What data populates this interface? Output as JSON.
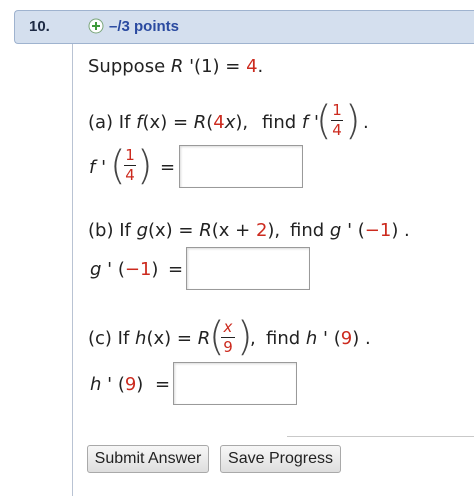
{
  "question": {
    "number": "10.",
    "points": "–/3 points"
  },
  "intro": {
    "text_a": "Suppose ",
    "var": "R",
    "text_b": " '(1) = ",
    "value": "4",
    "text_c": "."
  },
  "part_a": {
    "label": "(a) If ",
    "f": "f",
    "x1": "(x)",
    "eq": " = ",
    "R": "R",
    "arg_open": "(",
    "coef": "4",
    "x2": "x",
    "arg_close": "),",
    "find": "find ",
    "fprime": "f",
    "prime": " '",
    "frac_num": "1",
    "frac_den": "4",
    "period": ".",
    "answer_prefix_f": "f",
    "answer_prime": " '",
    "answer_eq": "=",
    "answer_value": ""
  },
  "part_b": {
    "label": "(b) If ",
    "g": "g",
    "x1": "(x)",
    "eq": " = ",
    "R": "R",
    "arg_a": "(x + ",
    "shift": "2",
    "arg_b": "),",
    "find": "find ",
    "gprime": "g",
    "prime_open": " ' (",
    "point": "−1",
    "prime_close": ") .",
    "answer_g": "g",
    "answer_prime_open": " ' (",
    "answer_point": "−1",
    "answer_close": ")",
    "answer_eq": "=",
    "answer_value": ""
  },
  "part_c": {
    "label": "(c) If ",
    "h": "h",
    "x1": "(x)",
    "eq": " = ",
    "R": "R",
    "frac_num": "x",
    "frac_den": "9",
    "comma": ",",
    "find": "find ",
    "hprime": "h",
    "prime_open": " ' (",
    "point": "9",
    "prime_close": ") .",
    "answer_h": "h",
    "answer_prime_open": " ' (",
    "answer_point": "9",
    "answer_close": ")",
    "answer_eq": "=",
    "answer_value": ""
  },
  "buttons": {
    "submit": "Submit Answer",
    "save": "Save Progress"
  },
  "colors": {
    "accent_red": "#cc2a1e",
    "header_bg": "#d4dfee",
    "points_blue": "#2a4aa0",
    "plus_green": "#3e9a3a"
  },
  "icons": {
    "expand": "plus-circle-icon"
  }
}
